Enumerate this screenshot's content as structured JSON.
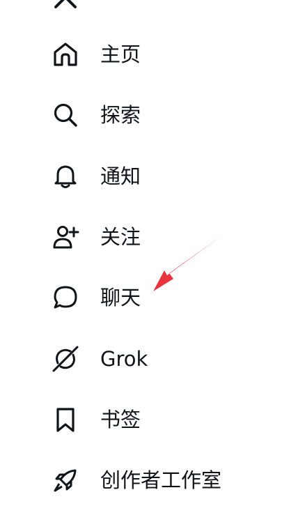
{
  "nav": {
    "items": [
      {
        "label": "主页",
        "icon": "home-icon"
      },
      {
        "label": "探索",
        "icon": "search-icon"
      },
      {
        "label": "通知",
        "icon": "bell-icon"
      },
      {
        "label": "关注",
        "icon": "person-add-icon"
      },
      {
        "label": "聊天",
        "icon": "chat-bubble-icon"
      },
      {
        "label": "Grok",
        "icon": "grok-icon"
      },
      {
        "label": "书签",
        "icon": "bookmark-icon"
      },
      {
        "label": "创作者工作室",
        "icon": "rocket-icon"
      }
    ]
  },
  "annotation": {
    "arrow_color": "#e8343c",
    "arrow_target": "聊天"
  },
  "colors": {
    "text": "#0f1419",
    "background": "#ffffff"
  }
}
